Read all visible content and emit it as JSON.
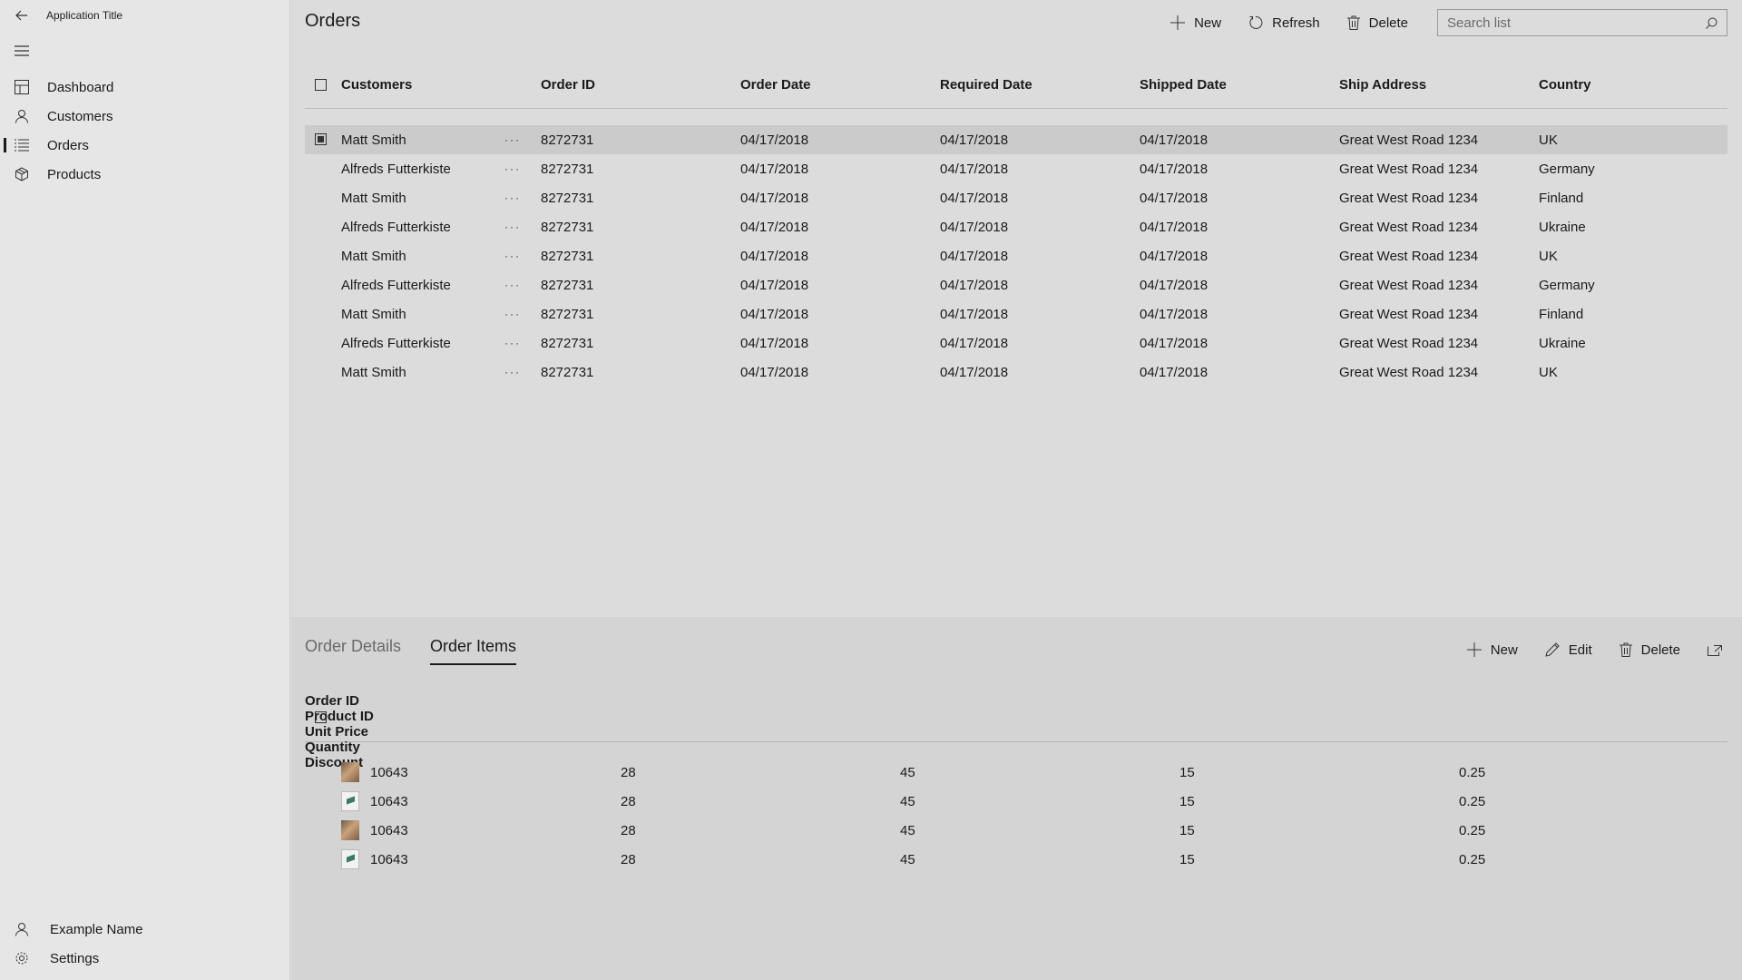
{
  "app": {
    "title": "Application Title"
  },
  "sidebar": {
    "items": [
      {
        "label": "Dashboard",
        "icon": "dashboard-icon"
      },
      {
        "label": "Customers",
        "icon": "person-icon"
      },
      {
        "label": "Orders",
        "icon": "list-icon",
        "active": true
      },
      {
        "label": "Products",
        "icon": "box-icon"
      }
    ],
    "user": {
      "label": "Example Name",
      "icon": "person-icon"
    },
    "settings": {
      "label": "Settings",
      "icon": "gear-icon"
    }
  },
  "main": {
    "title": "Orders",
    "commands": {
      "new": "New",
      "refresh": "Refresh",
      "delete": "Delete"
    },
    "search": {
      "placeholder": "Search list",
      "value": ""
    },
    "columns": [
      "Customers",
      "Order ID",
      "Order Date",
      "Required Date",
      "Shipped Date",
      "Ship Address",
      "Country"
    ],
    "rows": [
      [
        "Matt Smith",
        "8272731",
        "04/17/2018",
        "04/17/2018",
        "04/17/2018",
        "Great West Road 1234",
        "UK"
      ],
      [
        "Alfreds Futterkiste",
        "8272731",
        "04/17/2018",
        "04/17/2018",
        "04/17/2018",
        "Great West Road 1234",
        "Germany"
      ],
      [
        "Matt Smith",
        "8272731",
        "04/17/2018",
        "04/17/2018",
        "04/17/2018",
        "Great West Road 1234",
        "Finland"
      ],
      [
        "Alfreds Futterkiste",
        "8272731",
        "04/17/2018",
        "04/17/2018",
        "04/17/2018",
        "Great West Road 1234",
        "Ukraine"
      ],
      [
        "Matt Smith",
        "8272731",
        "04/17/2018",
        "04/17/2018",
        "04/17/2018",
        "Great West Road 1234",
        "UK"
      ],
      [
        "Alfreds Futterkiste",
        "8272731",
        "04/17/2018",
        "04/17/2018",
        "04/17/2018",
        "Great West Road 1234",
        "Germany"
      ],
      [
        "Matt Smith",
        "8272731",
        "04/17/2018",
        "04/17/2018",
        "04/17/2018",
        "Great West Road 1234",
        "Finland"
      ],
      [
        "Alfreds Futterkiste",
        "8272731",
        "04/17/2018",
        "04/17/2018",
        "04/17/2018",
        "Great West Road 1234",
        "Ukraine"
      ],
      [
        "Matt Smith",
        "8272731",
        "04/17/2018",
        "04/17/2018",
        "04/17/2018",
        "Great West Road 1234",
        "UK"
      ]
    ],
    "selected_row": 0,
    "more_glyph": "···"
  },
  "detail": {
    "tabs": [
      {
        "label": "Order Details",
        "active": false
      },
      {
        "label": "Order Items",
        "active": true
      }
    ],
    "commands": {
      "new": "New",
      "edit": "Edit",
      "delete": "Delete"
    },
    "columns": [
      "Order ID",
      "Product ID",
      "Unit Price",
      "Quantity",
      "Discount"
    ],
    "rows": [
      {
        "thumb": "photo",
        "values": [
          "10643",
          "28",
          "45",
          "15",
          "0.25"
        ]
      },
      {
        "thumb": "flag",
        "values": [
          "10643",
          "28",
          "45",
          "15",
          "0.25"
        ]
      },
      {
        "thumb": "photo",
        "values": [
          "10643",
          "28",
          "45",
          "15",
          "0.25"
        ]
      },
      {
        "thumb": "flag",
        "values": [
          "10643",
          "28",
          "45",
          "15",
          "0.25"
        ]
      }
    ]
  }
}
